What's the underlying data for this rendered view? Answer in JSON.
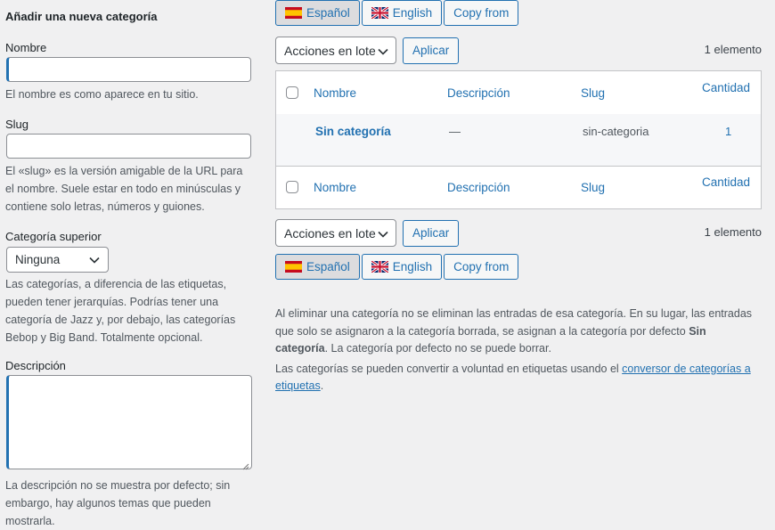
{
  "form": {
    "heading": "Añadir una nueva categoría",
    "name_label": "Nombre",
    "name_value": "",
    "name_help": "El nombre es como aparece en tu sitio.",
    "slug_label": "Slug",
    "slug_value": "",
    "slug_help": "El «slug» es la versión amigable de la URL para el nombre. Suele estar en todo en minúsculas y contiene solo letras, números y guiones.",
    "parent_label": "Categoría superior",
    "parent_selected": "Ninguna",
    "parent_help": "Las categorías, a diferencia de las etiquetas, pueden tener jerarquías. Podrías tener una categoría de Jazz y, por debajo, las categorías Bebop y Big Band. Totalmente opcional.",
    "description_label": "Descripción",
    "description_value": "",
    "description_help": "La descripción no se muestra por defecto; sin embargo, hay algunos temas que pueden mostrarla."
  },
  "languages": {
    "es": "Español",
    "en": "English",
    "copy_from": "Copy from"
  },
  "bulk": {
    "selected": "Acciones en lote",
    "apply": "Aplicar",
    "count": "1 elemento"
  },
  "table": {
    "col_name": "Nombre",
    "col_description": "Descripción",
    "col_slug": "Slug",
    "col_count": "Cantidad",
    "rows": [
      {
        "name": "Sin categoría",
        "description": "—",
        "slug": "sin-categoria",
        "count": "1"
      }
    ]
  },
  "notes": {
    "p1_a": "Al eliminar una categoría no se eliminan las entradas de esa categoría. En su lugar, las entradas que solo se asignaron a la categoría borrada, se asignan a la categoría por defecto ",
    "p1_b": "Sin categoría",
    "p1_c": ". La categoría por defecto no se puede borrar.",
    "p2_a": "Las categorías se pueden convertir a voluntad en etiquetas usando el ",
    "p2_link": "conversor de categorías a etiquetas",
    "p2_c": "."
  },
  "colors": {
    "accent": "#2271b1",
    "background": "#f0f0f1",
    "text": "#3c434a"
  }
}
